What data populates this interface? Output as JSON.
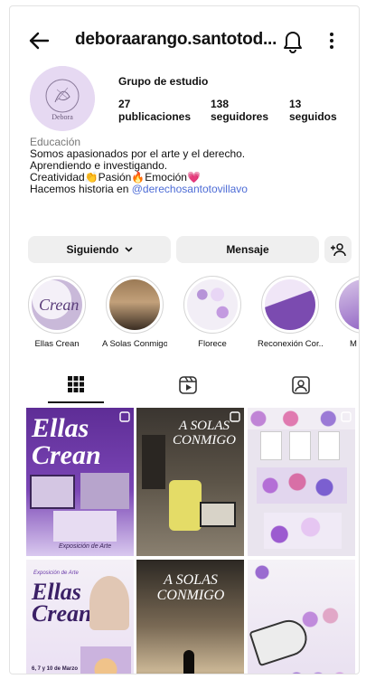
{
  "header": {
    "username": "deboraarango.santotod..."
  },
  "profile": {
    "avatar_text": "Debora",
    "title": "Grupo de estudio",
    "stats": [
      {
        "num": "27",
        "label": "publicaciones"
      },
      {
        "num": "138",
        "label": "seguidores"
      },
      {
        "num": "13",
        "label": "seguidos"
      }
    ],
    "bio": {
      "category": "Educación",
      "line1": "Somos apasionados por el arte y el derecho.",
      "line2": "Aprendiendo e investigando.",
      "line3": "Creatividad👏Pasión🔥Emoción💗",
      "line4_prefix": "Hacemos historia en ",
      "line4_mention": "@derechosantotovillavo"
    }
  },
  "actions": {
    "follow_label": "Siguiendo",
    "message_label": "Mensaje"
  },
  "highlights": [
    {
      "label": "Ellas Crean"
    },
    {
      "label": "A Solas Conmigo"
    },
    {
      "label": "Florece"
    },
    {
      "label": "Reconexión Cor..."
    },
    {
      "label": "M"
    }
  ],
  "posts": {
    "p1_title": "Ellas Crean",
    "p1_caption": "Exposición de Arte",
    "p2_title": "A SOLAS CONMIGO",
    "p4_title": "Ellas Crean",
    "p4_sub": "Exposición de Arte",
    "p4_date": "6, 7 y 10 de Marzo",
    "p5_title": "A SOLAS CONMIGO"
  },
  "colors": {
    "accent_purple": "#6a3aa8",
    "mention": "#4d6cd6",
    "button_bg": "#efefef"
  }
}
